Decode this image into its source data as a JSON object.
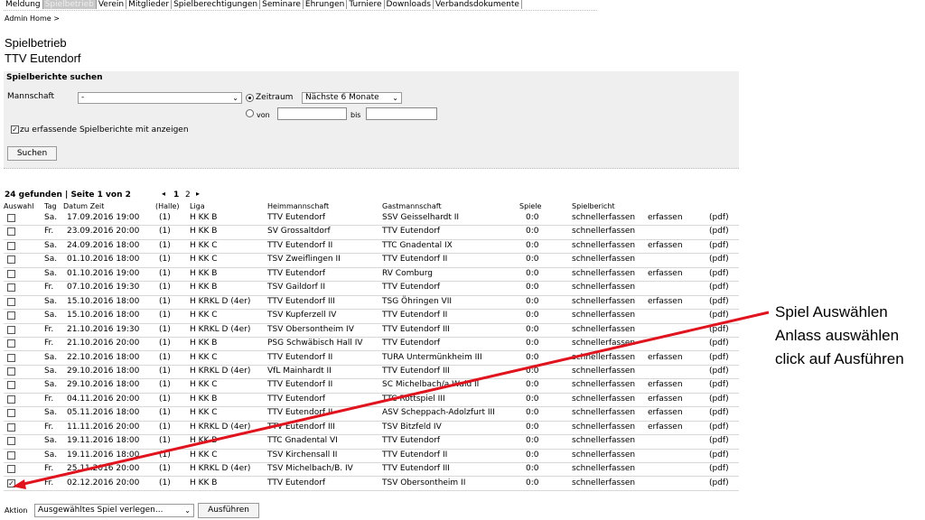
{
  "nav": [
    "Meldung",
    "Spielbetrieb",
    "Verein",
    "Mitglieder",
    "Spielberechtigungen",
    "Seminare",
    "Ehrungen",
    "Turniere",
    "Downloads",
    "Verbandsdokumente"
  ],
  "nav_active": 1,
  "breadcrumb": "Admin Home >",
  "title": "Spielbetrieb",
  "subtitle": "TTV Eutendorf",
  "search": {
    "title": "Spielberichte suchen",
    "mannschaft_label": "Mannschaft",
    "mannschaft_value": "-",
    "zeitraum_label": "Zeitraum",
    "zeitraum_value": "Nächste 6 Monate",
    "von_label": "von",
    "bis_label": "bis",
    "checkbox_label": "zu erfassende Spielberichte mit anzeigen",
    "submit": "Suchen"
  },
  "results": {
    "summary": "24 gefunden | Seite 1 von 2",
    "pages": [
      "1",
      "2"
    ],
    "prev": "◂",
    "next": "▸"
  },
  "columns": [
    "Auswahl",
    "Tag",
    "Datum Zeit",
    "(Halle)",
    "Liga",
    "Heimmannschaft",
    "Gastmannschaft",
    "Spiele",
    "Spielbericht"
  ],
  "rows": [
    {
      "tag": "Sa.",
      "datum": "17.09.2016 19:00",
      "halle": "(1)",
      "liga": "H KK B",
      "heim": "TTV Eutendorf",
      "gast": "SSV Geisselhardt II",
      "spiele": "0:0",
      "b1": "schnellerfassen",
      "b2": "erfassen",
      "pdf": "(pdf)",
      "checked": false
    },
    {
      "tag": "Fr.",
      "datum": "23.09.2016 20:00",
      "halle": "(1)",
      "liga": "H KK B",
      "heim": "SV Grossaltdorf",
      "gast": "TTV Eutendorf",
      "spiele": "0:0",
      "b1": "schnellerfassen",
      "b2": "",
      "pdf": "(pdf)",
      "checked": false
    },
    {
      "tag": "Sa.",
      "datum": "24.09.2016 18:00",
      "halle": "(1)",
      "liga": "H KK C",
      "heim": "TTV Eutendorf II",
      "gast": "TTC Gnadental IX",
      "spiele": "0:0",
      "b1": "schnellerfassen",
      "b2": "erfassen",
      "pdf": "(pdf)",
      "checked": false
    },
    {
      "tag": "Sa.",
      "datum": "01.10.2016 18:00",
      "halle": "(1)",
      "liga": "H KK C",
      "heim": "TSV Zweiflingen II",
      "gast": "TTV Eutendorf II",
      "spiele": "0:0",
      "b1": "schnellerfassen",
      "b2": "",
      "pdf": "(pdf)",
      "checked": false
    },
    {
      "tag": "Sa.",
      "datum": "01.10.2016 19:00",
      "halle": "(1)",
      "liga": "H KK B",
      "heim": "TTV Eutendorf",
      "gast": "RV Comburg",
      "spiele": "0:0",
      "b1": "schnellerfassen",
      "b2": "erfassen",
      "pdf": "(pdf)",
      "checked": false
    },
    {
      "tag": "Fr.",
      "datum": "07.10.2016 19:30",
      "halle": "(1)",
      "liga": "H KK B",
      "heim": "TSV Gaildorf II",
      "gast": "TTV Eutendorf",
      "spiele": "0:0",
      "b1": "schnellerfassen",
      "b2": "",
      "pdf": "(pdf)",
      "checked": false
    },
    {
      "tag": "Sa.",
      "datum": "15.10.2016 18:00",
      "halle": "(1)",
      "liga": "H KRKL D (4er)",
      "heim": "TTV Eutendorf III",
      "gast": "TSG Öhringen VII",
      "spiele": "0:0",
      "b1": "schnellerfassen",
      "b2": "erfassen",
      "pdf": "(pdf)",
      "checked": false
    },
    {
      "tag": "Sa.",
      "datum": "15.10.2016 18:00",
      "halle": "(1)",
      "liga": "H KK C",
      "heim": "TSV Kupferzell IV",
      "gast": "TTV Eutendorf II",
      "spiele": "0:0",
      "b1": "schnellerfassen",
      "b2": "",
      "pdf": "(pdf)",
      "checked": false
    },
    {
      "tag": "Fr.",
      "datum": "21.10.2016 19:30",
      "halle": "(1)",
      "liga": "H KRKL D (4er)",
      "heim": "TSV Obersontheim IV",
      "gast": "TTV Eutendorf III",
      "spiele": "0:0",
      "b1": "schnellerfassen",
      "b2": "",
      "pdf": "(pdf)",
      "checked": false
    },
    {
      "tag": "Fr.",
      "datum": "21.10.2016 20:00",
      "halle": "(1)",
      "liga": "H KK B",
      "heim": "PSG Schwäbisch Hall IV",
      "gast": "TTV Eutendorf",
      "spiele": "0:0",
      "b1": "schnellerfassen",
      "b2": "",
      "pdf": "(pdf)",
      "checked": false
    },
    {
      "tag": "Sa.",
      "datum": "22.10.2016 18:00",
      "halle": "(1)",
      "liga": "H KK C",
      "heim": "TTV Eutendorf II",
      "gast": "TURA Untermünkheim III",
      "spiele": "0:0",
      "b1": "schnellerfassen",
      "b2": "erfassen",
      "pdf": "(pdf)",
      "checked": false
    },
    {
      "tag": "Sa.",
      "datum": "29.10.2016 18:00",
      "halle": "(1)",
      "liga": "H KRKL D (4er)",
      "heim": "VfL Mainhardt II",
      "gast": "TTV Eutendorf III",
      "spiele": "0:0",
      "b1": "schnellerfassen",
      "b2": "",
      "pdf": "(pdf)",
      "checked": false
    },
    {
      "tag": "Sa.",
      "datum": "29.10.2016 18:00",
      "halle": "(1)",
      "liga": "H KK C",
      "heim": "TTV Eutendorf II",
      "gast": "SC Michelbach/a.Wald II",
      "spiele": "0:0",
      "b1": "schnellerfassen",
      "b2": "erfassen",
      "pdf": "(pdf)",
      "checked": false
    },
    {
      "tag": "Fr.",
      "datum": "04.11.2016 20:00",
      "halle": "(1)",
      "liga": "H KK B",
      "heim": "TTV Eutendorf",
      "gast": "TTC Rottspiel III",
      "spiele": "0:0",
      "b1": "schnellerfassen",
      "b2": "erfassen",
      "pdf": "(pdf)",
      "checked": false
    },
    {
      "tag": "Sa.",
      "datum": "05.11.2016 18:00",
      "halle": "(1)",
      "liga": "H KK C",
      "heim": "TTV Eutendorf II",
      "gast": "ASV Scheppach-Adolzfurt III",
      "spiele": "0:0",
      "b1": "schnellerfassen",
      "b2": "erfassen",
      "pdf": "(pdf)",
      "checked": false
    },
    {
      "tag": "Fr.",
      "datum": "11.11.2016 20:00",
      "halle": "(1)",
      "liga": "H KRKL D (4er)",
      "heim": "TTV Eutendorf III",
      "gast": "TSV Bitzfeld IV",
      "spiele": "0:0",
      "b1": "schnellerfassen",
      "b2": "erfassen",
      "pdf": "(pdf)",
      "checked": false
    },
    {
      "tag": "Sa.",
      "datum": "19.11.2016 18:00",
      "halle": "(1)",
      "liga": "H KK B",
      "heim": "TTC Gnadental VI",
      "gast": "TTV Eutendorf",
      "spiele": "0:0",
      "b1": "schnellerfassen",
      "b2": "",
      "pdf": "(pdf)",
      "checked": false
    },
    {
      "tag": "Sa.",
      "datum": "19.11.2016 18:00",
      "halle": "(1)",
      "liga": "H KK C",
      "heim": "TSV Kirchensall II",
      "gast": "TTV Eutendorf II",
      "spiele": "0:0",
      "b1": "schnellerfassen",
      "b2": "",
      "pdf": "(pdf)",
      "checked": false
    },
    {
      "tag": "Fr.",
      "datum": "25.11.2016 20:00",
      "halle": "(1)",
      "liga": "H KRKL D (4er)",
      "heim": "TSV Michelbach/B. IV",
      "gast": "TTV Eutendorf III",
      "spiele": "0:0",
      "b1": "schnellerfassen",
      "b2": "",
      "pdf": "(pdf)",
      "checked": false
    },
    {
      "tag": "Fr.",
      "datum": "02.12.2016 20:00",
      "halle": "(1)",
      "liga": "H KK B",
      "heim": "TTV Eutendorf",
      "gast": "TSV Obersontheim II",
      "spiele": "0:0",
      "b1": "schnellerfassen",
      "b2": "",
      "pdf": "(pdf)",
      "checked": true
    }
  ],
  "action": {
    "label": "Aktion",
    "select_value": "Ausgewähltes Spiel verlegen...",
    "button": "Ausführen"
  },
  "annotation": [
    "Spiel Auswählen",
    "Anlass auswählen",
    "click auf Ausführen"
  ],
  "annotation_color": "#e0141e"
}
